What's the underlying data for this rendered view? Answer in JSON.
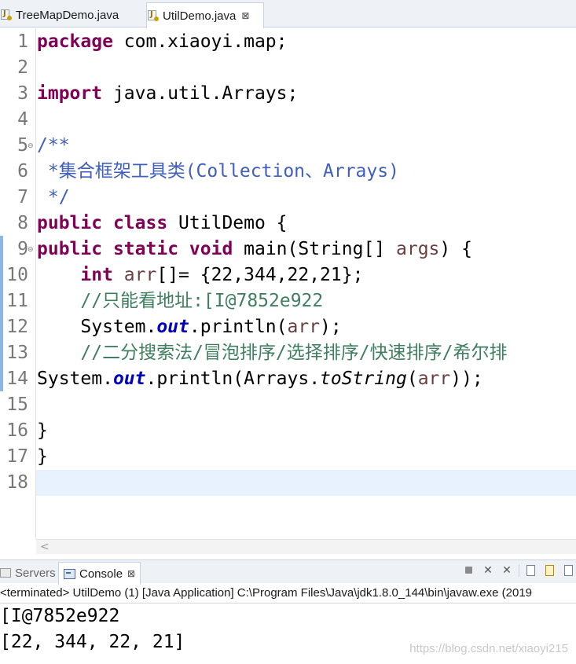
{
  "editor_tabs": [
    {
      "label": "TreeMapDemo.java",
      "active": false
    },
    {
      "label": "UtilDemo.java",
      "active": true,
      "close": "⊠"
    }
  ],
  "code_lines": [
    {
      "n": "1",
      "fold": "",
      "tokens": [
        {
          "t": "package",
          "c": "kw"
        },
        {
          "t": " com.xiaoyi.map;"
        }
      ]
    },
    {
      "n": "2",
      "fold": "",
      "tokens": []
    },
    {
      "n": "3",
      "fold": "",
      "tokens": [
        {
          "t": "import",
          "c": "kw"
        },
        {
          "t": " java.util.Arrays;"
        }
      ]
    },
    {
      "n": "4",
      "fold": "",
      "tokens": []
    },
    {
      "n": "5",
      "fold": "⊖",
      "tokens": [
        {
          "t": "/**",
          "c": "doc"
        }
      ]
    },
    {
      "n": "6",
      "fold": "",
      "tokens": [
        {
          "t": " *集合框架工具类(Collection、Arrays)",
          "c": "doc"
        }
      ]
    },
    {
      "n": "7",
      "fold": "",
      "tokens": [
        {
          "t": " */",
          "c": "doc"
        }
      ]
    },
    {
      "n": "8",
      "fold": "",
      "tokens": [
        {
          "t": "public",
          "c": "kw"
        },
        {
          "t": " "
        },
        {
          "t": "class",
          "c": "kw"
        },
        {
          "t": " UtilDemo {"
        }
      ]
    },
    {
      "n": "9",
      "fold": "⊖",
      "tokens": [
        {
          "t": "public",
          "c": "kw"
        },
        {
          "t": " "
        },
        {
          "t": "static",
          "c": "kw"
        },
        {
          "t": " "
        },
        {
          "t": "void",
          "c": "kw"
        },
        {
          "t": " main(String[] "
        },
        {
          "t": "args",
          "c": "var"
        },
        {
          "t": ") {"
        }
      ]
    },
    {
      "n": "10",
      "fold": "",
      "tokens": [
        {
          "t": "    "
        },
        {
          "t": "int",
          "c": "kw"
        },
        {
          "t": " "
        },
        {
          "t": "arr",
          "c": "var"
        },
        {
          "t": "[]= {22,344,22,21};"
        }
      ]
    },
    {
      "n": "11",
      "fold": "",
      "tokens": [
        {
          "t": "    "
        },
        {
          "t": "//只能看地址:[I@7852e922",
          "c": "cm"
        }
      ]
    },
    {
      "n": "12",
      "fold": "",
      "tokens": [
        {
          "t": "    System."
        },
        {
          "t": "out",
          "c": "fld"
        },
        {
          "t": ".println("
        },
        {
          "t": "arr",
          "c": "var"
        },
        {
          "t": ");"
        }
      ]
    },
    {
      "n": "13",
      "fold": "",
      "tokens": [
        {
          "t": "    "
        },
        {
          "t": "//二分搜索法/冒泡排序/选择排序/快速排序/希尔排",
          "c": "cm"
        }
      ]
    },
    {
      "n": "14",
      "fold": "",
      "tokens": [
        {
          "t": "System."
        },
        {
          "t": "out",
          "c": "fld"
        },
        {
          "t": ".println(Arrays."
        },
        {
          "t": "toString",
          "c": "mth"
        },
        {
          "t": "("
        },
        {
          "t": "arr",
          "c": "var"
        },
        {
          "t": "));"
        }
      ]
    },
    {
      "n": "15",
      "fold": "",
      "tokens": []
    },
    {
      "n": "16",
      "fold": "",
      "tokens": [
        {
          "t": "}"
        }
      ]
    },
    {
      "n": "17",
      "fold": "",
      "tokens": [
        {
          "t": "}"
        }
      ]
    },
    {
      "n": "18",
      "fold": "",
      "tokens": []
    }
  ],
  "active_line": "18",
  "hscroll_arrow": "<",
  "console": {
    "servers_label": "Servers",
    "console_label": "Console",
    "close": "⊠",
    "status": "<terminated> UtilDemo (1) [Java Application] C:\\Program Files\\Java\\jdk1.8.0_144\\bin\\javaw.exe (2019",
    "output": [
      "[I@7852e922",
      "[22, 344, 22, 21]"
    ]
  },
  "watermark": "https://blog.csdn.net/xiaoyi215",
  "colors": {
    "keyword": "#7f0055",
    "javadoc": "#3f5fbf",
    "comment": "#3f7f5f",
    "field": "#0000c0",
    "local_var": "#6a3e3e",
    "active_line": "#e8f2fe"
  }
}
